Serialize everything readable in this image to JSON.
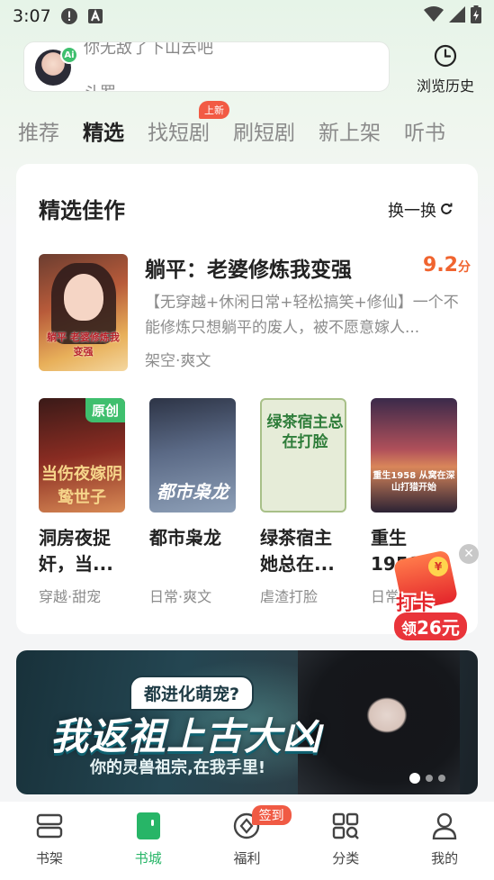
{
  "status_bar": {
    "time": "3:07"
  },
  "search": {
    "line1": "你无敌了下山去吧",
    "line2": "斗罗"
  },
  "history": {
    "label": "浏览历史"
  },
  "tabs": [
    {
      "label": "推荐"
    },
    {
      "label": "精选"
    },
    {
      "label": "找短剧",
      "badge": "上新"
    },
    {
      "label": "刷短剧"
    },
    {
      "label": "新上架"
    },
    {
      "label": "听书"
    }
  ],
  "section": {
    "title": "精选佳作",
    "refresh_label": "换一换"
  },
  "featured": {
    "title": "躺平：老婆修炼我变强",
    "score": "9.2",
    "score_unit": "分",
    "desc": "【无穿越+休闲日常+轻松搞笑+修仙】一个不能修炼只想躺平的废人，被不愿意嫁人...",
    "tags": "架空·爽文",
    "cover_text": "躺平 老婆修炼我变强"
  },
  "books": [
    {
      "name": "洞房夜捉奸，当...",
      "tags": "穿越·甜宠",
      "badge": "原创",
      "cover_text": "当伤夜嫁阴鸷世子"
    },
    {
      "name": "都市枭龙",
      "tags": "日常·爽文",
      "cover_text": "都市枭龙"
    },
    {
      "name": "绿茶宿主她总在...",
      "tags": "虐渣打脸",
      "cover_text": "绿茶宿主总在打脸"
    },
    {
      "name": "重生1958...",
      "tags": "日常",
      "cover_text": "重生1958 从窝在深山打猎开始"
    }
  ],
  "promo": {
    "line1": "打卡",
    "line2_prefix": "领",
    "line2_amount": "26元",
    "coin": "¥"
  },
  "banner": {
    "pill": "都进化萌宠?",
    "headline": "我返祖上古大凶",
    "sub": "你的灵兽祖宗,在我手里!"
  },
  "navbar": [
    {
      "label": "书架"
    },
    {
      "label": "书城"
    },
    {
      "label": "福利",
      "badge": "签到"
    },
    {
      "label": "分类"
    },
    {
      "label": "我的"
    }
  ],
  "colors": {
    "accent": "#27b567",
    "score": "#f0642f",
    "badge": "#f25a44"
  }
}
